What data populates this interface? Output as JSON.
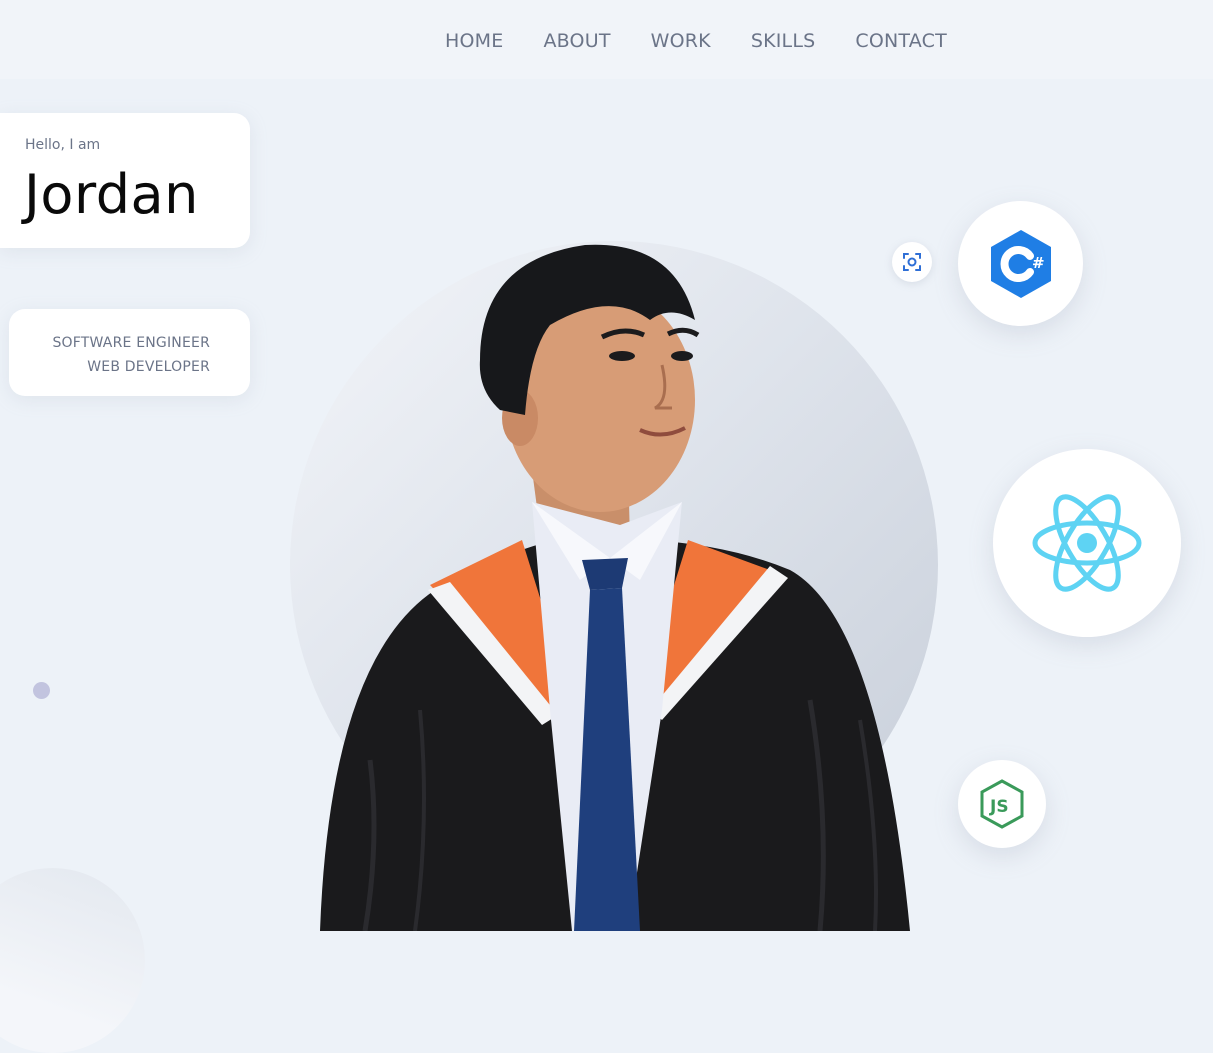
{
  "nav": {
    "items": [
      "HOME",
      "ABOUT",
      "WORK",
      "SKILLS",
      "CONTACT"
    ]
  },
  "greeting": {
    "hello": "Hello, I am",
    "name": "Jordan"
  },
  "roles": [
    "SOFTWARE ENGINEER",
    "WEB DEVELOPER"
  ],
  "skills": [
    {
      "icon": "csharp-icon",
      "color": "#1f7ee5"
    },
    {
      "icon": "react-icon",
      "color": "#5ed3f3"
    },
    {
      "icon": "nodejs-icon",
      "color": "#3a9a5a"
    }
  ],
  "colors": {
    "background": "#edf2f8",
    "navbar": "#f1f4f9",
    "nav_text": "#6b7488",
    "accent_dot": "#c2c4df"
  }
}
